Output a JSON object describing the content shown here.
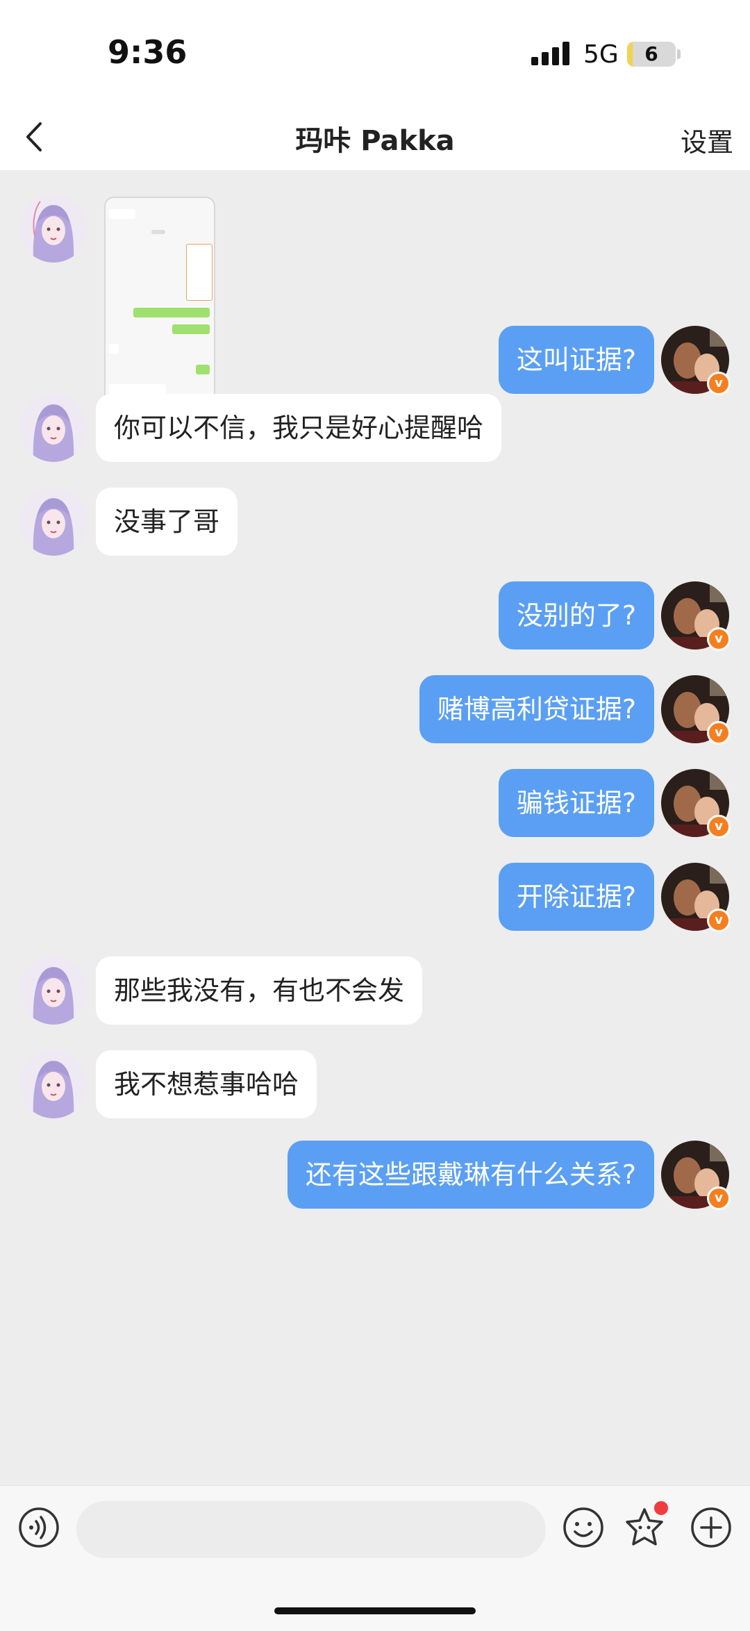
{
  "status_bar": {
    "time": "9:36",
    "network": "5G",
    "battery": "6",
    "battery_level": 0.06
  },
  "nav": {
    "title": "玛咔 Pakka",
    "settings_label": "设置"
  },
  "messages": [
    {
      "side": "in",
      "type": "image"
    },
    {
      "side": "out",
      "text": "这叫证据?"
    },
    {
      "side": "in",
      "text": "你可以不信，我只是好心提醒哈"
    },
    {
      "side": "in",
      "text": "没事了哥"
    },
    {
      "side": "out",
      "text": "没别的了?"
    },
    {
      "side": "out",
      "text": "赌博高利贷证据?"
    },
    {
      "side": "out",
      "text": "骗钱证据?"
    },
    {
      "side": "out",
      "text": "开除证据?"
    },
    {
      "side": "in",
      "text": "那些我没有，有也不会发"
    },
    {
      "side": "in",
      "text": "我不想惹事哈哈"
    },
    {
      "side": "out",
      "text": "还有这些跟戴琳有什么关系?"
    }
  ],
  "input_bar": {
    "icons": [
      "voice-icon",
      "emoji-icon",
      "sticker-icon",
      "plus-icon"
    ],
    "placeholder": ""
  },
  "colors": {
    "outgoing_bubble": "#5a9ff3",
    "incoming_bubble": "#ffffff",
    "chat_background": "#ededed",
    "badge": "#f57f20"
  }
}
